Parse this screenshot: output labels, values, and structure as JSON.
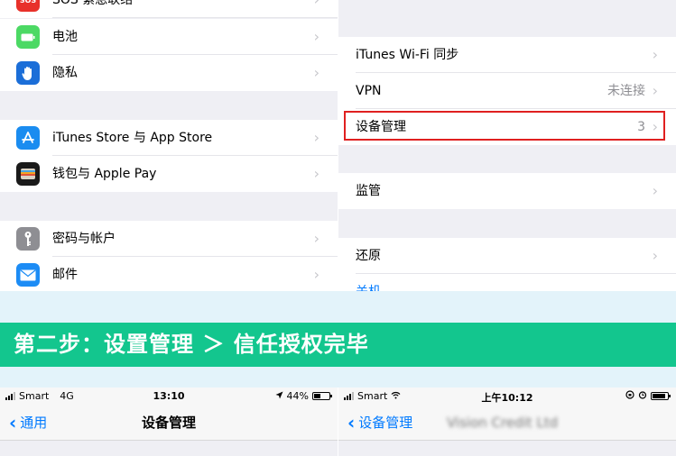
{
  "left_settings": {
    "rows": [
      {
        "label": "SOS 紧急联络",
        "icon": "sos-icon",
        "icon_color": "#e8312a"
      },
      {
        "label": "电池",
        "icon": "battery-icon",
        "icon_color": "#4cd964"
      },
      {
        "label": "隐私",
        "icon": "hand-icon",
        "icon_color": "#1b6ed8"
      },
      {
        "label": "iTunes Store 与 App Store",
        "icon": "app-store-icon",
        "icon_color": "#1a8cf0"
      },
      {
        "label": "钱包与 Apple Pay",
        "icon": "wallet-icon",
        "icon_color": "#1a1a1a"
      },
      {
        "label": "密码与帐户",
        "icon": "key-icon",
        "icon_color": "#8e8e93"
      },
      {
        "label": "邮件",
        "icon": "mail-icon",
        "icon_color": "#1c8cf5"
      }
    ]
  },
  "right_settings": {
    "rows": [
      {
        "label": "iTunes Wi-Fi 同步",
        "value": ""
      },
      {
        "label": "VPN",
        "value": "未连接"
      },
      {
        "label": "设备管理",
        "value": "3"
      },
      {
        "label": "监管",
        "value": ""
      },
      {
        "label": "还原",
        "value": ""
      },
      {
        "label": "关机",
        "value": ""
      }
    ],
    "highlight_color": "#e02020"
  },
  "banner": {
    "text": "第二步：设置管理 ＞ 信任授权完毕",
    "strip_color": "#13c68e",
    "background": "#e3f3fa"
  },
  "phone_left": {
    "carrier": "Smart",
    "network": "4G",
    "time": "13:10",
    "battery_text": "44%",
    "battery_level": 0.44,
    "back_label": "通用",
    "title": "设备管理"
  },
  "phone_right": {
    "carrier": "Smart",
    "time": "上午10:12",
    "battery_level": 0.9,
    "back_label": "设备管理",
    "title": "Vision Credit Ltd"
  }
}
